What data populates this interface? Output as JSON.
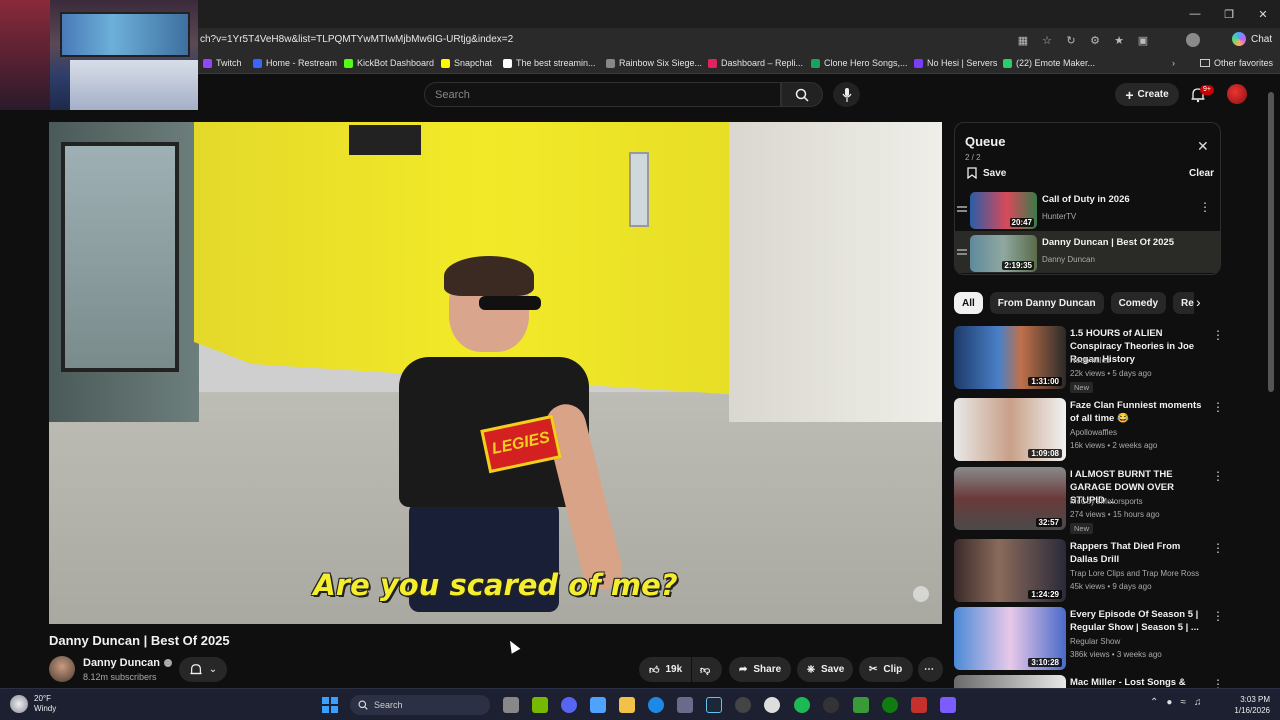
{
  "browser": {
    "url": "ch?v=1Yr5T4VeH8w&list=TLPQMTYwMTIwMjbMw6IG-URtjg&index=2",
    "chat_label": "Chat",
    "bookmarks": [
      {
        "label": "Twitch",
        "color": "#9146ff"
      },
      {
        "label": "Home - Restream",
        "color": "#3a64ff"
      },
      {
        "label": "KickBot Dashboard",
        "color": "#53fc18"
      },
      {
        "label": "Snapchat",
        "color": "#fffc00"
      },
      {
        "label": "The best streamin...",
        "color": "#ffffff"
      },
      {
        "label": "Rainbow Six Siege...",
        "color": "#888888"
      },
      {
        "label": "Dashboard – Repli...",
        "color": "#e0245e"
      },
      {
        "label": "Clone Hero Songs,...",
        "color": "#1aa260"
      },
      {
        "label": "No Hesi | Servers",
        "color": "#7a3cff"
      },
      {
        "label": "(22) Emote Maker...",
        "color": "#2ecc71"
      }
    ],
    "other_favorites": "Other favorites"
  },
  "header": {
    "search_placeholder": "Search",
    "create_label": "Create",
    "notif_badge": "9+"
  },
  "video": {
    "caption": "Are you scared of me?",
    "shirt_text": "LEGIES",
    "title": "Danny Duncan | Best Of 2025",
    "channel": "Danny Duncan",
    "subscribers": "8.12m subscribers",
    "likes": "19k",
    "share_label": "Share",
    "save_label": "Save",
    "clip_label": "Clip"
  },
  "queue": {
    "title": "Queue",
    "count": "2 / 2",
    "save_label": "Save",
    "clear_label": "Clear",
    "items": [
      {
        "title": "Call of Duty in 2026",
        "channel": "HunterTV",
        "duration": "20:47"
      },
      {
        "title": "Danny Duncan | Best Of 2025",
        "channel": "Danny Duncan",
        "duration": "2:19:35"
      }
    ]
  },
  "chips": [
    "All",
    "From Danny Duncan",
    "Comedy",
    "Related"
  ],
  "recommended": [
    {
      "title": "1.5 HOURS of ALIEN Conspiracy Theories in Joe Rogan History",
      "channel": "Noah Miles",
      "meta": "22k views • 5 days ago",
      "badge": "New",
      "duration": "1:31:00"
    },
    {
      "title": "Faze Clan Funniest moments of all time 😂",
      "channel": "Apollowaffles",
      "meta": "16k views • 2 weeks ago",
      "badge": "",
      "duration": "1:09:08"
    },
    {
      "title": "I ALMOST BURNT THE GARAGE DOWN OVER STUPID ...",
      "channel": "McCoy'sMotorsports",
      "meta": "274 views • 15 hours ago",
      "badge": "New",
      "duration": "32:57"
    },
    {
      "title": "Rappers That Died From Dallas Drill",
      "channel": "Trap Lore Clips and Trap More Ross",
      "meta": "45k views • 9 days ago",
      "badge": "",
      "duration": "1:24:29"
    },
    {
      "title": "Every Episode Of Season 5 | Regular Show | Season 5 | ...",
      "channel": "Regular Show",
      "meta": "386k views • 3 weeks ago",
      "badge": "",
      "duration": "3:10:28"
    },
    {
      "title": "Mac Miller - Lost Songs &",
      "channel": "",
      "meta": "",
      "badge": "",
      "duration": ""
    }
  ],
  "taskbar": {
    "temp": "20°F",
    "weather": "Windy",
    "search_label": "Search",
    "time": "3:03 PM",
    "date": "1/16/2026"
  }
}
